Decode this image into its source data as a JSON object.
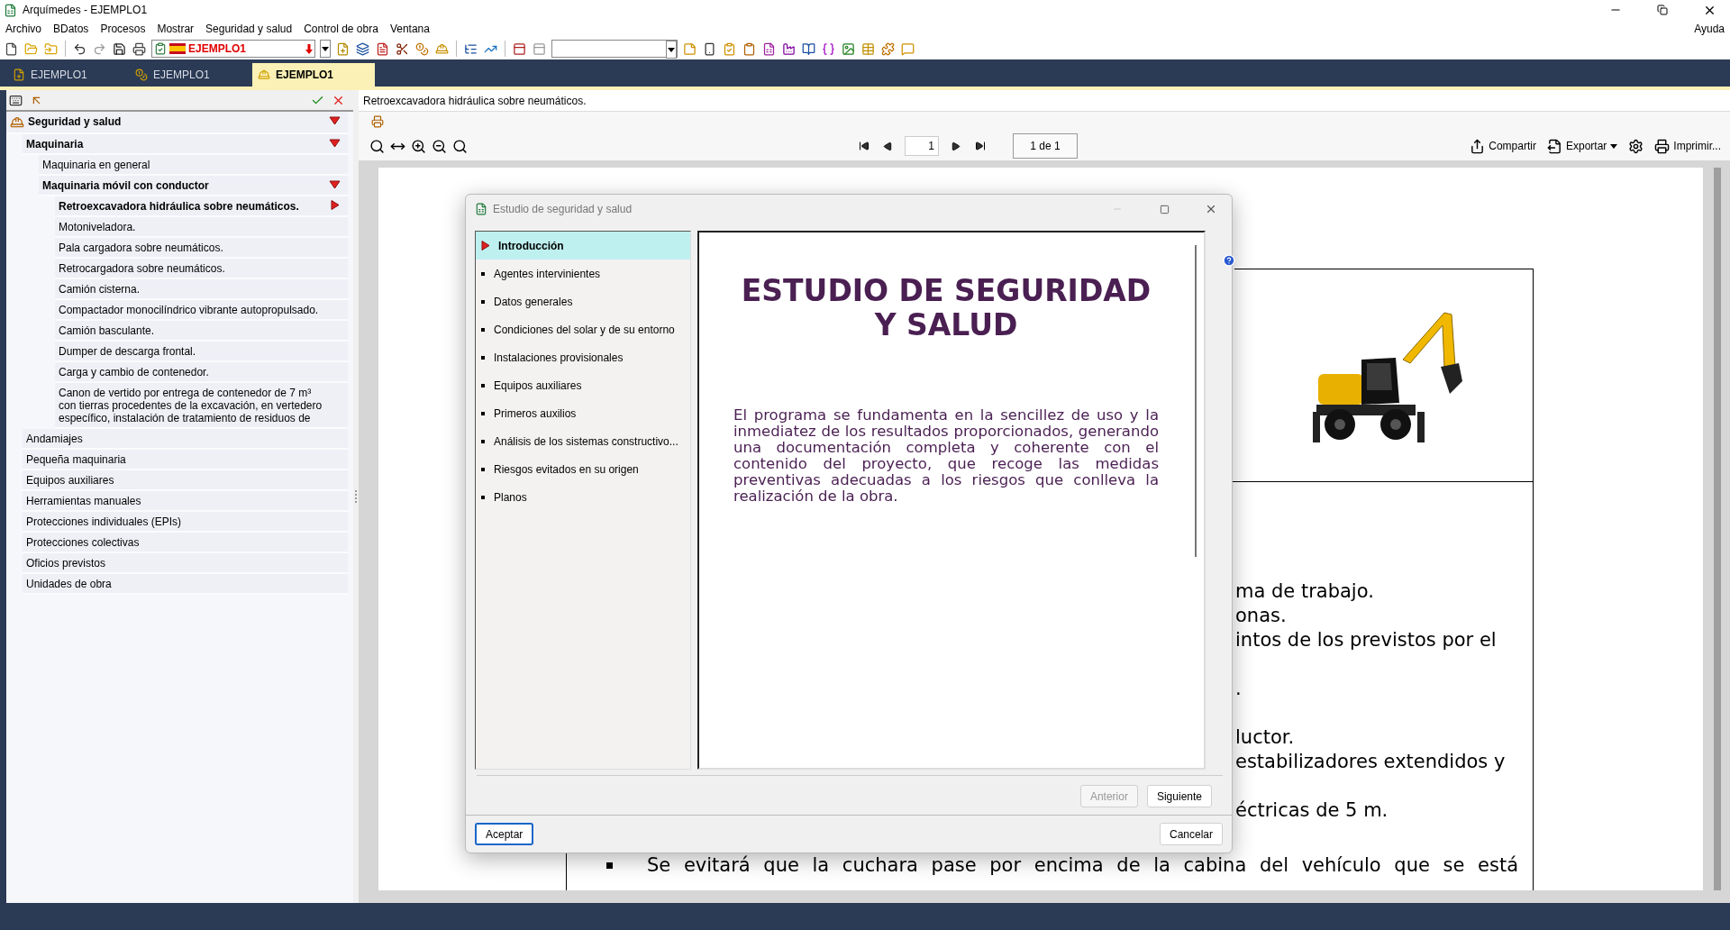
{
  "window": {
    "title": "Arquímedes - EJEMPLO1"
  },
  "menu": {
    "items": [
      "Archivo",
      "BDatos",
      "Procesos",
      "Mostrar",
      "Seguridad y salud",
      "Control de obra",
      "Ventana"
    ],
    "help": "Ayuda"
  },
  "toolbar": {
    "project": "EJEMPLO1"
  },
  "tabs": [
    {
      "label": "EJEMPLO1",
      "selected": false
    },
    {
      "label": "EJEMPLO1",
      "selected": false
    },
    {
      "label": "EJEMPLO1",
      "selected": true
    }
  ],
  "tree": [
    {
      "label": "Seguridad y salud",
      "expanded": true,
      "selected": false,
      "children": [
        {
          "label": "Maquinaria",
          "expanded": true,
          "selected": false,
          "children": [
            {
              "label": "Maquinaria en general",
              "expanded": false,
              "selected": false
            },
            {
              "label": "Maquinaria móvil con conductor",
              "expanded": true,
              "selected": false,
              "children": [
                {
                  "label": "Retroexcavadora hidráulica sobre neumáticos.",
                  "expanded": false,
                  "selected": true
                },
                {
                  "label": "Motoniveladora.",
                  "expanded": false,
                  "selected": false
                },
                {
                  "label": "Pala cargadora sobre neumáticos.",
                  "expanded": false,
                  "selected": false
                },
                {
                  "label": "Retrocargadora sobre neumáticos.",
                  "expanded": false,
                  "selected": false
                },
                {
                  "label": "Camión cisterna.",
                  "expanded": false,
                  "selected": false
                },
                {
                  "label": "Compactador monocilíndrico vibrante autopropulsado.",
                  "expanded": false,
                  "selected": false
                },
                {
                  "label": "Camión basculante.",
                  "expanded": false,
                  "selected": false
                },
                {
                  "label": "Dumper de descarga frontal.",
                  "expanded": false,
                  "selected": false
                },
                {
                  "label": "Carga y cambio de contenedor.",
                  "expanded": false,
                  "selected": false
                },
                {
                  "label": "Canon de vertido por entrega de contenedor de 7 m³\ncon tierras procedentes de la excavación, en vertedero\nespecífico, instalación de tratamiento de residuos de",
                  "expanded": false,
                  "selected": false
                }
              ]
            }
          ]
        },
        {
          "label": "Andamiajes",
          "expanded": false,
          "selected": false
        },
        {
          "label": "Pequeña maquinaria",
          "expanded": false,
          "selected": false
        },
        {
          "label": "Equipos auxiliares",
          "expanded": false,
          "selected": false
        },
        {
          "label": "Herramientas manuales",
          "expanded": false,
          "selected": false
        },
        {
          "label": "Protecciones individuales (EPIs)",
          "expanded": false,
          "selected": false
        },
        {
          "label": "Protecciones colectivas",
          "expanded": false,
          "selected": false
        },
        {
          "label": "Oficios previstos",
          "expanded": false,
          "selected": false
        },
        {
          "label": "Unidades de obra",
          "expanded": false,
          "selected": false
        }
      ]
    }
  ],
  "viewer": {
    "heading": "Retroexcavadora hidráulica sobre neumáticos.",
    "page_input": "1",
    "page_count": "1 de 1",
    "actions": [
      {
        "kind": "text",
        "label": "Compartir",
        "dropdown": false
      },
      {
        "kind": "text",
        "label": "Exportar",
        "dropdown": true
      },
      {
        "kind": "icon"
      },
      {
        "kind": "text",
        "label": "Imprimir...",
        "dropdown": false
      }
    ]
  },
  "document": {
    "paragraphs": [
      [
        "ma de trabajo.",
        "onas.",
        "intos de los previstos por el"
      ],
      [
        "."
      ],
      [
        "luctor.",
        "estabilizadores extendidos y"
      ],
      [
        "éctricas de 5 m."
      ]
    ],
    "bullet_line": "Se evitará que la cuchara pase por encima de la cabina del vehículo que se está"
  },
  "dialog": {
    "title": "Estudio de seguridad y salud",
    "nav": [
      {
        "label": "Introducción",
        "selected": true
      },
      {
        "label": "Agentes intervinientes",
        "selected": false
      },
      {
        "label": "Datos generales",
        "selected": false
      },
      {
        "label": "Condiciones del solar y de su entorno",
        "selected": false
      },
      {
        "label": "Instalaciones provisionales",
        "selected": false
      },
      {
        "label": "Equipos auxiliares",
        "selected": false
      },
      {
        "label": "Primeros auxilios",
        "selected": false
      },
      {
        "label": "Análisis de los sistemas constructivo...",
        "selected": false
      },
      {
        "label": "Riesgos evitados en su origen",
        "selected": false
      },
      {
        "label": "Planos",
        "selected": false
      }
    ],
    "heading": "ESTUDIO DE SEGURIDAD Y SALUD",
    "body": "El programa se fundamenta en la sencillez de uso y la inmediatez de los resultados proporcionados, generando una documentación completa y coherente con el contenido del proyecto, que recoge las medidas preventivas adecuadas a los riesgos que conlleva la realización de la obra.",
    "previous": {
      "label": "Anterior",
      "disabled": true
    },
    "next": {
      "label": "Siguiente",
      "disabled": false
    },
    "accept": "Aceptar",
    "cancel": "Cancelar"
  }
}
